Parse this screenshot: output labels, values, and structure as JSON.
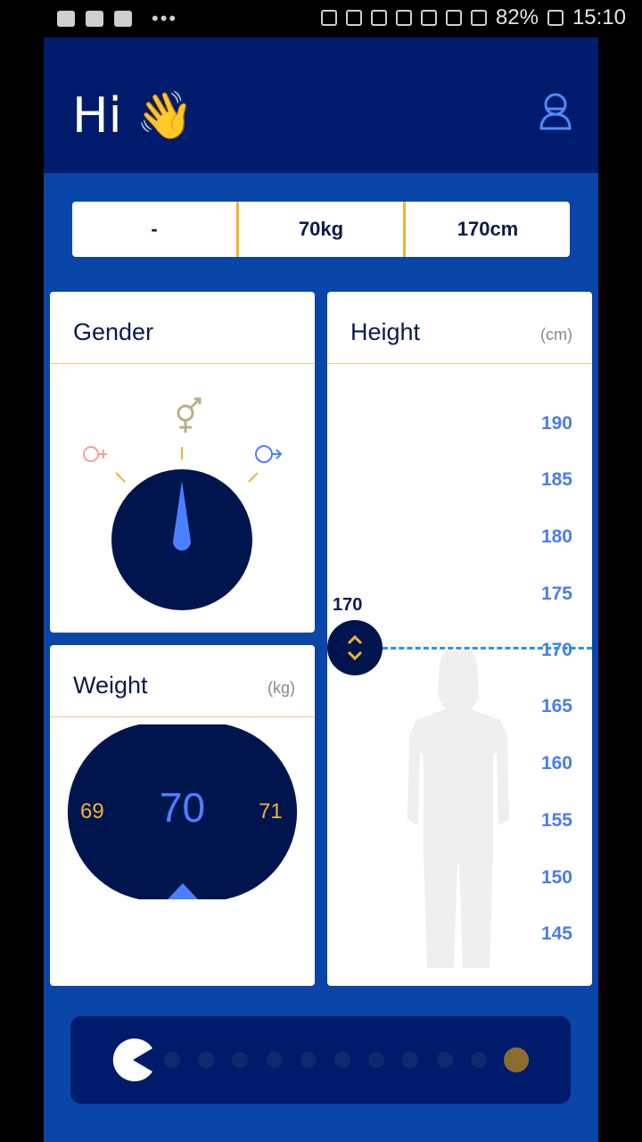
{
  "status_bar": {
    "battery": "82%",
    "time": "15:10"
  },
  "header": {
    "greeting": "Hi",
    "wave_emoji": "👋",
    "profile_icon": "avatar-icon"
  },
  "summary": {
    "gender": "-",
    "weight": "70kg",
    "height": "170cm"
  },
  "gender_card": {
    "title": "Gender",
    "options": [
      "female",
      "other",
      "male"
    ],
    "selected": "other",
    "symbols": {
      "female": "♀",
      "other": "⚥",
      "male": "♂"
    }
  },
  "weight_card": {
    "title": "Weight",
    "unit": "(kg)",
    "prev": "69",
    "current": "70",
    "next": "71"
  },
  "height_card": {
    "title": "Height",
    "unit": "(cm)",
    "ticks": [
      "190",
      "185",
      "180",
      "175",
      "170",
      "165",
      "160",
      "155",
      "150",
      "145"
    ],
    "selected_label": "170"
  },
  "progress": {
    "total_steps": 11,
    "current_step": 1
  },
  "colors": {
    "header_bg": "#001b6b",
    "app_bg": "#0a45a8",
    "accent": "#f2b233",
    "primary_blue": "#4c7fff"
  }
}
